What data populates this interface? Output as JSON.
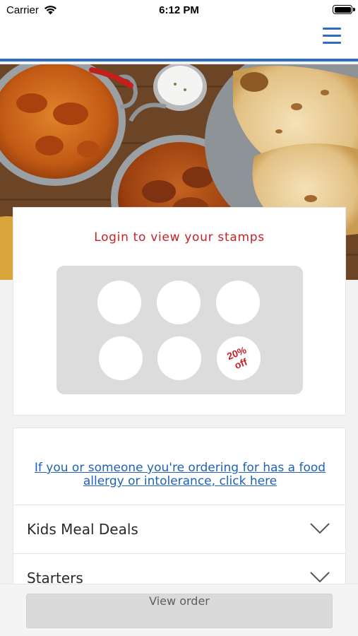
{
  "status_bar": {
    "carrier": "Carrier",
    "time": "6:12 PM",
    "icons": [
      "wifi-icon",
      "battery-icon"
    ]
  },
  "nav": {
    "menu_icon": "hamburger-menu-icon",
    "accent_color": "#2e6dc2"
  },
  "hero": {
    "image": "indian-curry-dishes-naan-photo"
  },
  "stamp_card": {
    "title": "Login to view your stamps",
    "stamps_total": 6,
    "stamps_collected": 0,
    "reward_line1": "20%",
    "reward_line2": "off",
    "title_color": "#c62229"
  },
  "menu": {
    "allergy_link": "If you or someone you're ordering for has a food allergy or intolerance, click here",
    "categories": [
      {
        "label": "Kids Meal Deals"
      },
      {
        "label": "Starters"
      }
    ]
  },
  "footer": {
    "view_order_label": "View order"
  }
}
